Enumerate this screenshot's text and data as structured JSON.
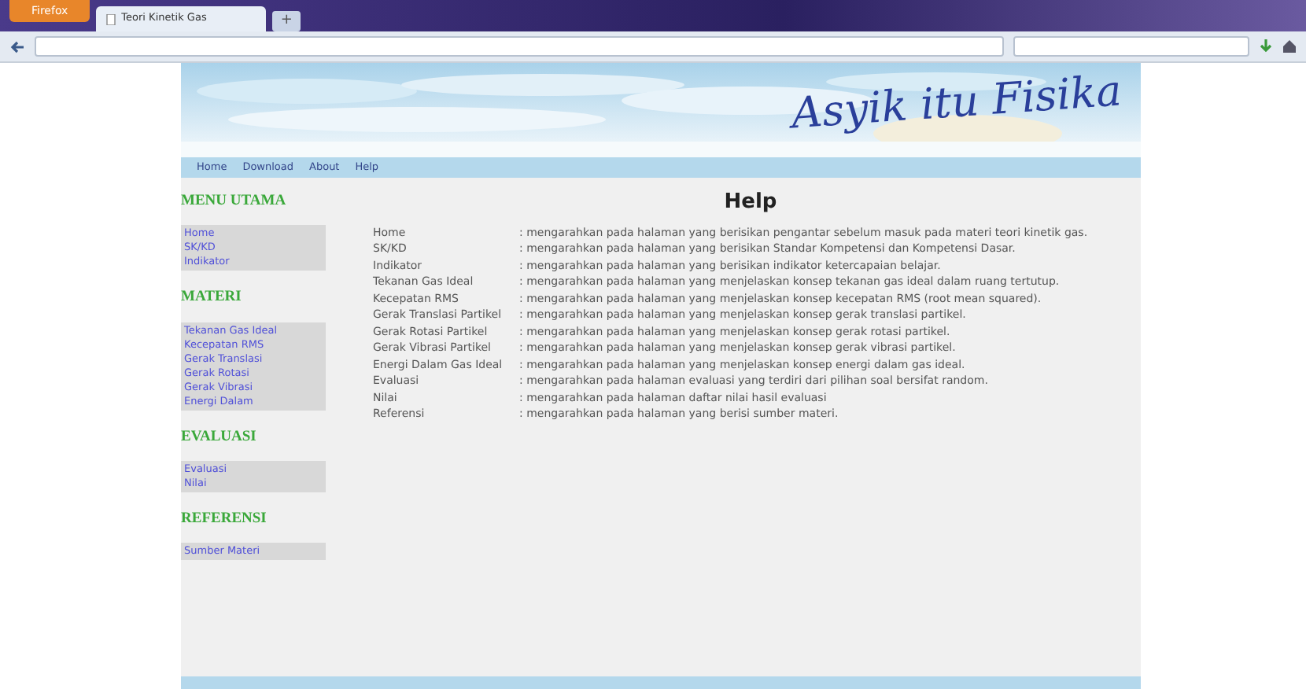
{
  "browser": {
    "menu_button": "Firefox",
    "tab_title": "Teori Kinetik Gas",
    "new_tab": "+"
  },
  "site_title": "Asyik itu Fisika",
  "nav": [
    "Home",
    "Download",
    "About",
    "Help"
  ],
  "sidebar": [
    {
      "heading": "MENU UTAMA",
      "items": [
        "Home",
        "SK/KD",
        "Indikator"
      ]
    },
    {
      "heading": "MATERI",
      "items": [
        "Tekanan Gas Ideal",
        "Kecepatan RMS",
        "Gerak Translasi",
        "Gerak Rotasi",
        "Gerak Vibrasi",
        "Energi Dalam"
      ]
    },
    {
      "heading": "EVALUASI",
      "items": [
        "Evaluasi",
        "Nilai"
      ]
    },
    {
      "heading": "REFERENSI",
      "items": [
        "Sumber Materi"
      ]
    }
  ],
  "page_heading": "Help",
  "help_rows": [
    {
      "term": "Home",
      "description": ": mengarahkan pada halaman yang berisikan pengantar sebelum masuk pada materi teori kinetik gas."
    },
    {
      "term": "SK/KD",
      "description": ": mengarahkan pada halaman yang berisikan Standar Kompetensi dan Kompetensi Dasar."
    },
    {
      "term": "Indikator",
      "description": ": mengarahkan pada halaman yang berisikan indikator ketercapaian belajar."
    },
    {
      "term": "Tekanan Gas Ideal",
      "description": ": mengarahkan pada halaman yang menjelaskan konsep tekanan gas ideal dalam ruang tertutup."
    },
    {
      "term": "Kecepatan RMS",
      "description": ": mengarahkan pada halaman yang menjelaskan konsep kecepatan RMS (root mean squared)."
    },
    {
      "term": "Gerak Translasi Partikel",
      "description": ": mengarahkan pada halaman yang menjelaskan konsep gerak translasi partikel."
    },
    {
      "term": "Gerak Rotasi Partikel",
      "description": ": mengarahkan pada halaman yang menjelaskan konsep gerak rotasi partikel."
    },
    {
      "term": "Gerak Vibrasi Partikel",
      "description": ": mengarahkan pada halaman yang menjelaskan konsep gerak vibrasi partikel."
    },
    {
      "term": "Energi Dalam Gas Ideal",
      "description": ": mengarahkan pada halaman yang menjelaskan konsep energi dalam gas ideal."
    },
    {
      "term": "Evaluasi",
      "description": ": mengarahkan pada halaman evaluasi yang terdiri dari pilihan soal bersifat random."
    },
    {
      "term": "Nilai",
      "description": ": mengarahkan pada halaman daftar nilai hasil evaluasi"
    },
    {
      "term": "Referensi",
      "description": ": mengarahkan pada halaman yang berisi sumber materi."
    }
  ]
}
